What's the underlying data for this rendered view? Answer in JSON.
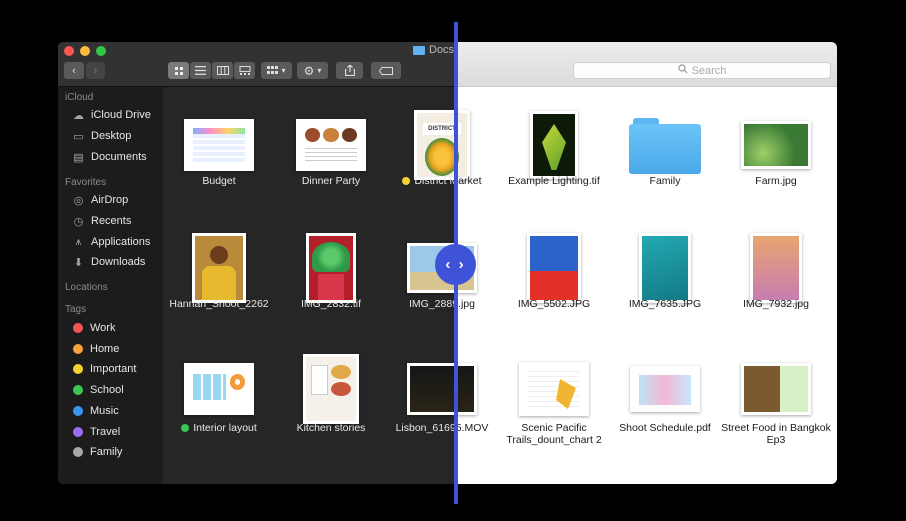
{
  "window": {
    "title": "Docs"
  },
  "search": {
    "placeholder": "Search"
  },
  "toolbar": {
    "back": "‹",
    "forward": "›",
    "views": [
      "icon-view",
      "list-view",
      "column-view",
      "gallery-view"
    ],
    "group": "group-menu",
    "action": "action-menu",
    "share": "share",
    "tag": "tag"
  },
  "sidebar": {
    "icloud_title": "iCloud",
    "icloud": [
      {
        "label": "iCloud Drive",
        "icon": "cloud-icon"
      },
      {
        "label": "Desktop",
        "icon": "desktop-icon"
      },
      {
        "label": "Documents",
        "icon": "documents-icon"
      }
    ],
    "favorites_title": "Favorites",
    "favorites": [
      {
        "label": "AirDrop",
        "icon": "airdrop-icon"
      },
      {
        "label": "Recents",
        "icon": "clock-icon"
      },
      {
        "label": "Applications",
        "icon": "applications-icon"
      },
      {
        "label": "Downloads",
        "icon": "download-icon"
      }
    ],
    "locations_title": "Locations",
    "tags_title": "Tags",
    "tags": [
      {
        "label": "Work",
        "color": "#f25555"
      },
      {
        "label": "Home",
        "color": "#f5a33b"
      },
      {
        "label": "Important",
        "color": "#f3d234"
      },
      {
        "label": "School",
        "color": "#39c757"
      },
      {
        "label": "Music",
        "color": "#3d95f3"
      },
      {
        "label": "Travel",
        "color": "#9a6df0"
      },
      {
        "label": "Family",
        "color": "#a9a9a9"
      }
    ]
  },
  "files": [
    {
      "name": "Budget"
    },
    {
      "name": "Dinner Party"
    },
    {
      "name": "District Market",
      "tag_color": "#f3d234"
    },
    {
      "name": "Example Lighting.tif"
    },
    {
      "name": "Family"
    },
    {
      "name": "Farm.jpg"
    },
    {
      "name": "Hannah_Shoot_2262"
    },
    {
      "name": "IMG_2832.tif"
    },
    {
      "name": "IMG_2889.jpg"
    },
    {
      "name": "IMG_5502.JPG"
    },
    {
      "name": "IMG_7635.JPG"
    },
    {
      "name": "IMG_7932.jpg"
    },
    {
      "name": "Interior layout",
      "tag_color": "#39c757"
    },
    {
      "name": "Kitchen stories"
    },
    {
      "name": "Lisbon_61695.MOV"
    },
    {
      "name": "Scenic Pacific Trails_dount_chart 2"
    },
    {
      "name": "Shoot Schedule.pdf"
    },
    {
      "name": "Street Food in Bangkok Ep3"
    }
  ],
  "divider": {
    "handle_label": "‹ ›"
  },
  "colors": {
    "accent": "#3e53d8",
    "dark_bg": "#262626",
    "sidebar_bg": "#1c1c1c"
  }
}
